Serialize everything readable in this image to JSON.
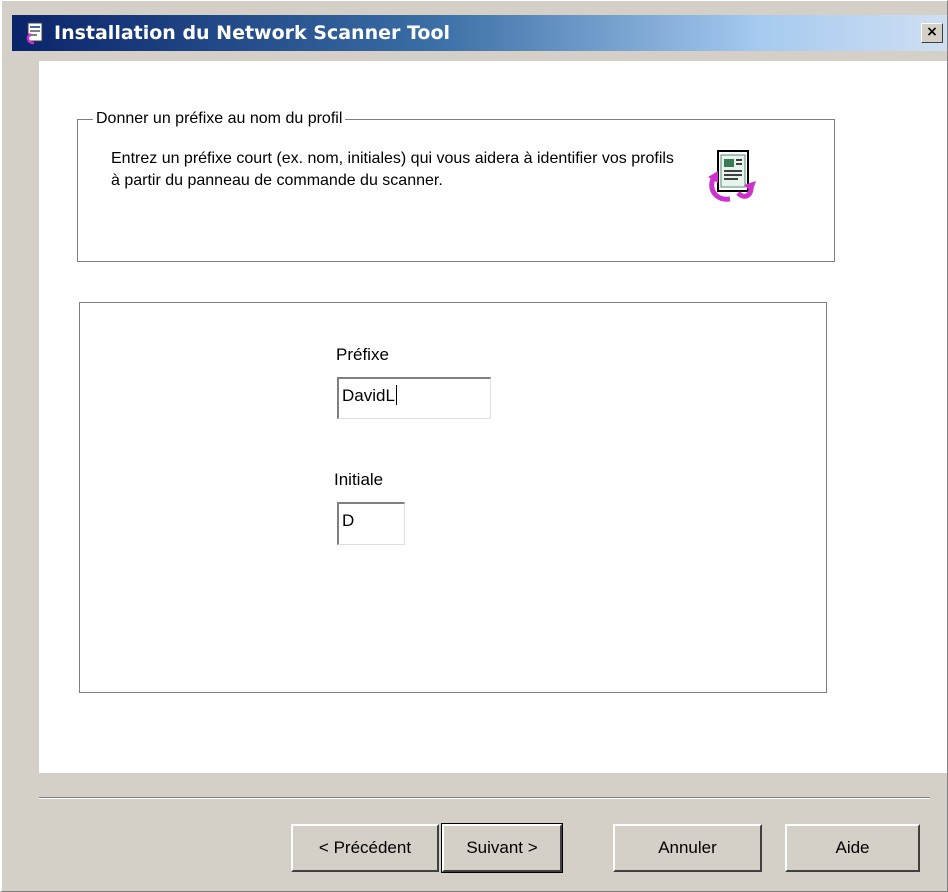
{
  "window": {
    "title": "Installation du Network Scanner Tool",
    "close_glyph": "×",
    "icon": "installer-icon"
  },
  "group": {
    "legend": "Donner un préfixe au nom du profil",
    "description": "Entrez un préfixe court (ex. nom, initiales) qui vous aidera à identifier vos profils à partir du panneau de commande du scanner.",
    "icon": "document-arrow-icon"
  },
  "fields": {
    "prefix_label": "Préfixe",
    "prefix_value": "DavidL",
    "initial_label": "Initiale",
    "initial_value": "D"
  },
  "buttons": {
    "previous": "< Précédent",
    "next": "Suivant >",
    "cancel": "Annuler",
    "help": "Aide"
  },
  "colors": {
    "title_gradient_start": "#0a246a",
    "title_gradient_end": "#a6caf0",
    "face": "#d4d0c8",
    "content_bg": "#ffffff",
    "icon_accent": "#cc33cc"
  }
}
